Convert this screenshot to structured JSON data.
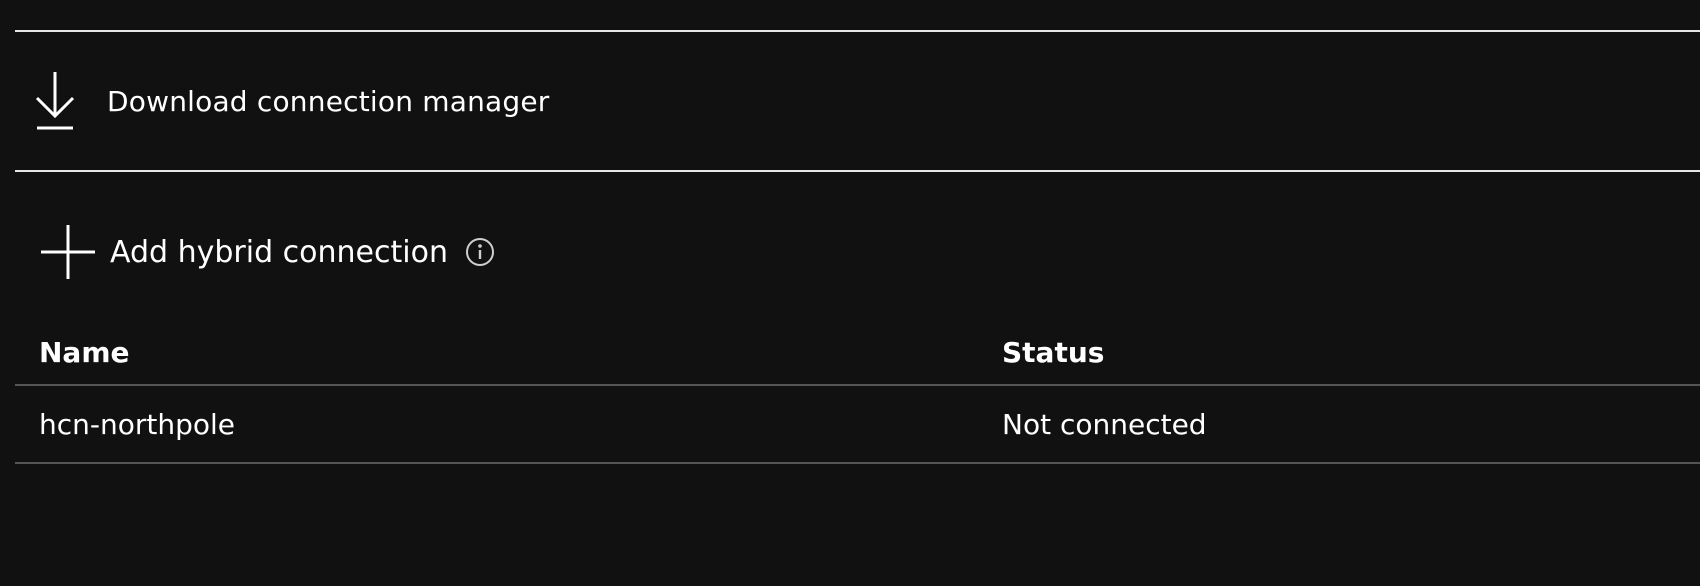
{
  "toolbar": {
    "download_label": "Download connection manager",
    "add_label": "Add hybrid connection"
  },
  "icons": {
    "download": "download-icon",
    "add": "plus-icon",
    "info": "info-icon"
  },
  "table": {
    "columns": [
      "Name",
      "Status"
    ],
    "rows": [
      {
        "name": "hcn-northpole",
        "status": "Not connected"
      }
    ]
  }
}
